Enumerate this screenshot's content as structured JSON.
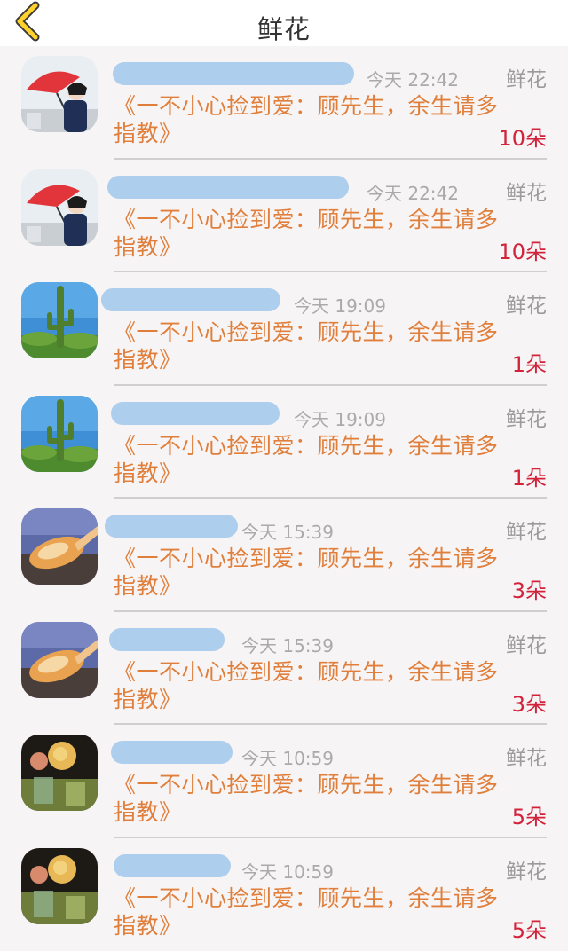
{
  "header": {
    "title": "鲜花"
  },
  "items": [
    {
      "avatar": "umbrella-avatar",
      "time": "今天 22:42",
      "type": "鲜花",
      "desc": "《一不小心捡到爱：顾先生，余生请多指教》",
      "count": "10朵"
    },
    {
      "avatar": "umbrella-avatar",
      "time": "今天 22:42",
      "type": "鲜花",
      "desc": "《一不小心捡到爱：顾先生，余生请多指教》",
      "count": "10朵"
    },
    {
      "avatar": "cactus-avatar",
      "time": "今天 19:09",
      "type": "鲜花",
      "desc": "《一不小心捡到爱：顾先生，余生请多指教》",
      "count": "1朵"
    },
    {
      "avatar": "cactus-avatar",
      "time": "今天 19:09",
      "type": "鲜花",
      "desc": "《一不小心捡到爱：顾先生，余生请多指教》",
      "count": "1朵"
    },
    {
      "avatar": "shell-avatar",
      "time": "今天 15:39",
      "type": "鲜花",
      "desc": "《一不小心捡到爱：顾先生，余生请多指教》",
      "count": "3朵"
    },
    {
      "avatar": "shell-avatar",
      "time": "今天 15:39",
      "type": "鲜花",
      "desc": "《一不小心捡到爱：顾先生，余生请多指教》",
      "count": "3朵"
    },
    {
      "avatar": "rose-avatar",
      "time": "今天 10:59",
      "type": "鲜花",
      "desc": "《一不小心捡到爱：顾先生，余生请多指教》",
      "count": "5朵"
    },
    {
      "avatar": "rose-avatar",
      "time": "今天 10:59",
      "type": "鲜花",
      "desc": "《一不小心捡到爱：顾先生，余生请多指教》",
      "count": "5朵"
    }
  ]
}
